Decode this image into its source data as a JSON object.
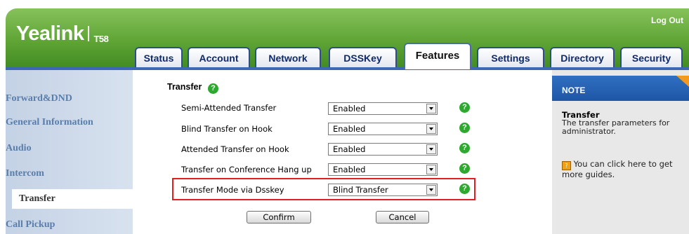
{
  "brand": {
    "name": "Yealink",
    "model": "T58"
  },
  "header": {
    "logout_label": "Log Out"
  },
  "tabs": [
    {
      "label": "Status"
    },
    {
      "label": "Account"
    },
    {
      "label": "Network"
    },
    {
      "label": "DSSKey"
    },
    {
      "label": "Features",
      "active": true
    },
    {
      "label": "Settings"
    },
    {
      "label": "Directory"
    },
    {
      "label": "Security"
    }
  ],
  "sidebar": {
    "items": [
      {
        "label": "Forward&DND"
      },
      {
        "label": "General Information"
      },
      {
        "label": "Audio"
      },
      {
        "label": "Intercom"
      },
      {
        "label": "Transfer",
        "active": true
      },
      {
        "label": "Call Pickup"
      }
    ]
  },
  "section": {
    "title": "Transfer"
  },
  "rows": [
    {
      "label": "Semi-Attended Transfer",
      "value": "Enabled"
    },
    {
      "label": "Blind Transfer on Hook",
      "value": "Enabled"
    },
    {
      "label": "Attended Transfer on Hook",
      "value": "Enabled"
    },
    {
      "label": "Transfer on Conference Hang up",
      "value": "Enabled"
    },
    {
      "label": "Transfer Mode via Dsskey",
      "value": "Blind Transfer",
      "highlighted": true
    }
  ],
  "buttons": {
    "confirm": "Confirm",
    "cancel": "Cancel"
  },
  "note": {
    "title": "NOTE",
    "subtitle": "Transfer",
    "text": "The transfer parameters for administrator.",
    "guide_icon": "?",
    "guide": "You can click here to get more guides."
  },
  "help_glyph": "?",
  "colors": {
    "header_green": "#5ea334",
    "tab_border": "#2f4c8c",
    "note_blue": "#1f56a6",
    "highlight_red": "#e02020",
    "help_green": "#2fa830"
  }
}
